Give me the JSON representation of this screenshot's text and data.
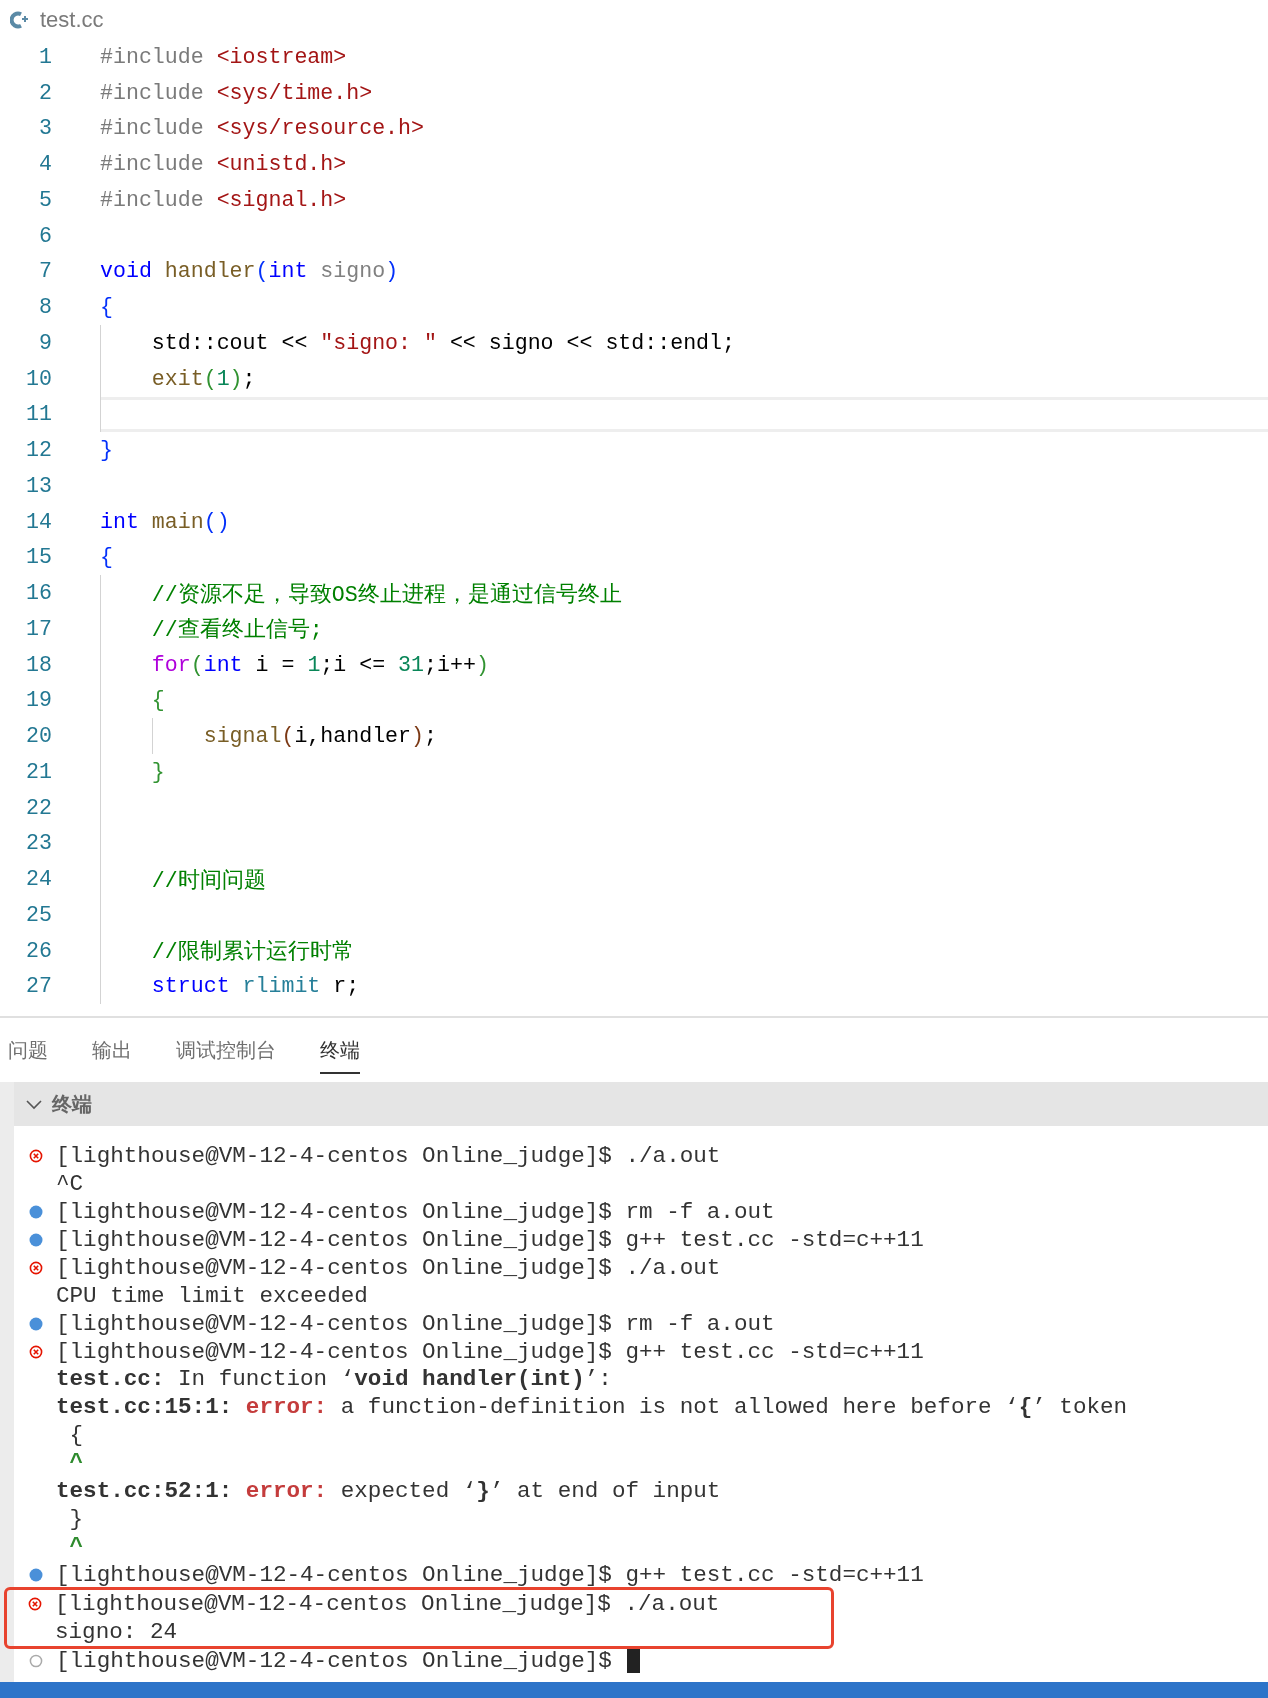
{
  "editor": {
    "file_name": "test.cc",
    "lines": [
      {
        "number": "1",
        "current": false,
        "tokens": [
          {
            "text": "#include ",
            "kind": "directive"
          },
          {
            "text": "<iostream>",
            "kind": "string"
          }
        ]
      },
      {
        "number": "2",
        "current": false,
        "tokens": [
          {
            "text": "#include ",
            "kind": "directive"
          },
          {
            "text": "<sys/time.h>",
            "kind": "string"
          }
        ]
      },
      {
        "number": "3",
        "current": false,
        "tokens": [
          {
            "text": "#include ",
            "kind": "directive"
          },
          {
            "text": "<sys/resource.h>",
            "kind": "string"
          }
        ]
      },
      {
        "number": "4",
        "current": false,
        "tokens": [
          {
            "text": "#include ",
            "kind": "directive"
          },
          {
            "text": "<unistd.h>",
            "kind": "string"
          }
        ]
      },
      {
        "number": "5",
        "current": false,
        "tokens": [
          {
            "text": "#include ",
            "kind": "directive"
          },
          {
            "text": "<signal.h>",
            "kind": "string"
          }
        ]
      },
      {
        "number": "6",
        "current": false
      },
      {
        "number": "7",
        "current": false,
        "tokens": [
          {
            "text": "void ",
            "kind": "keyword"
          },
          {
            "text": "handler",
            "kind": "function"
          },
          {
            "text": "(",
            "kind": "bracket1"
          },
          {
            "text": "int ",
            "kind": "keyword"
          },
          {
            "text": "signo",
            "kind": "param"
          },
          {
            "text": ")",
            "kind": "bracket1"
          }
        ]
      },
      {
        "number": "8",
        "current": false,
        "tokens": [
          {
            "text": "{",
            "kind": "bracket1"
          }
        ]
      },
      {
        "number": "9",
        "current": false,
        "tokens": [
          {
            "text": "    std::cout << ",
            "kind": "plain"
          },
          {
            "text": "\"signo: \"",
            "kind": "string"
          },
          {
            "text": " << signo << std::endl;",
            "kind": "plain"
          }
        ]
      },
      {
        "number": "10",
        "current": false,
        "tokens": [
          {
            "text": "    exit",
            "kind": "function"
          },
          {
            "text": "(",
            "kind": "bracket2"
          },
          {
            "text": "1",
            "kind": "number"
          },
          {
            "text": ")",
            "kind": "bracket2"
          },
          {
            "text": ";",
            "kind": "plain"
          }
        ]
      },
      {
        "number": "11",
        "current": true
      },
      {
        "number": "12",
        "current": false,
        "tokens": [
          {
            "text": "}",
            "kind": "bracket1"
          }
        ]
      },
      {
        "number": "13",
        "current": false
      },
      {
        "number": "14",
        "current": false,
        "tokens": [
          {
            "text": "int ",
            "kind": "keyword"
          },
          {
            "text": "main",
            "kind": "function"
          },
          {
            "text": "()",
            "kind": "bracket1"
          }
        ]
      },
      {
        "number": "15",
        "current": false,
        "tokens": [
          {
            "text": "{",
            "kind": "bracket1"
          }
        ]
      },
      {
        "number": "16",
        "current": false,
        "tokens": [
          {
            "text": "    //资源不足，导致OS终止进程，是通过信号终止",
            "kind": "comment"
          }
        ]
      },
      {
        "number": "17",
        "current": false,
        "tokens": [
          {
            "text": "    //查看终止信号;",
            "kind": "comment"
          }
        ]
      },
      {
        "number": "18",
        "current": false,
        "tokens": [
          {
            "text": "    for",
            "kind": "control"
          },
          {
            "text": "(",
            "kind": "bracket2"
          },
          {
            "text": "int",
            "kind": "keyword"
          },
          {
            "text": " i = ",
            "kind": "plain"
          },
          {
            "text": "1",
            "kind": "number"
          },
          {
            "text": ";i <= ",
            "kind": "plain"
          },
          {
            "text": "31",
            "kind": "number"
          },
          {
            "text": ";i++",
            "kind": "plain"
          },
          {
            "text": ")",
            "kind": "bracket2"
          }
        ]
      },
      {
        "number": "19",
        "current": false,
        "tokens": [
          {
            "text": "    {",
            "kind": "bracket2"
          }
        ]
      },
      {
        "number": "20",
        "current": false,
        "tokens": [
          {
            "text": "        signal",
            "kind": "function"
          },
          {
            "text": "(",
            "kind": "bracket3"
          },
          {
            "text": "i,handler",
            "kind": "plain"
          },
          {
            "text": ")",
            "kind": "bracket3"
          },
          {
            "text": ";",
            "kind": "plain"
          }
        ]
      },
      {
        "number": "21",
        "current": false,
        "tokens": [
          {
            "text": "    }",
            "kind": "bracket2"
          }
        ]
      },
      {
        "number": "22",
        "current": false
      },
      {
        "number": "23",
        "current": false
      },
      {
        "number": "24",
        "current": false,
        "tokens": [
          {
            "text": "    //时间问题",
            "kind": "comment"
          }
        ]
      },
      {
        "number": "25",
        "current": false
      },
      {
        "number": "26",
        "current": false,
        "tokens": [
          {
            "text": "    //限制累计运行时常",
            "kind": "comment"
          }
        ]
      },
      {
        "number": "27",
        "current": false,
        "tokens": [
          {
            "text": "    struct ",
            "kind": "keyword"
          },
          {
            "text": "rlimit",
            "kind": "type"
          },
          {
            "text": " r;",
            "kind": "plain"
          }
        ]
      }
    ]
  },
  "panel": {
    "tabs": [
      {
        "label": "问题",
        "selected": false
      },
      {
        "label": "输出",
        "selected": false
      },
      {
        "label": "调试控制台",
        "selected": false
      },
      {
        "label": "终端",
        "selected": true
      }
    ]
  },
  "terminal": {
    "title": "终端",
    "expanded": true,
    "lines": [
      {
        "kind": "error",
        "highlighted": false,
        "cursor": false,
        "parts": [
          {
            "text": "[lighthouse@VM-12-4-centos Online_judge]$ ./a.out",
            "kind": "plain"
          }
        ]
      },
      {
        "highlighted": false,
        "cursor": false,
        "parts": [
          {
            "text": "^C",
            "kind": "plain"
          }
        ]
      },
      {
        "kind": "success",
        "highlighted": false,
        "cursor": false,
        "parts": [
          {
            "text": "[lighthouse@VM-12-4-centos Online_judge]$ rm -f a.out",
            "kind": "plain"
          }
        ]
      },
      {
        "kind": "success",
        "highlighted": false,
        "cursor": false,
        "parts": [
          {
            "text": "[lighthouse@VM-12-4-centos Online_judge]$ g++ test.cc -std=c++11",
            "kind": "plain"
          }
        ]
      },
      {
        "kind": "error",
        "highlighted": false,
        "cursor": false,
        "parts": [
          {
            "text": "[lighthouse@VM-12-4-centos Online_judge]$ ./a.out",
            "kind": "plain"
          }
        ]
      },
      {
        "highlighted": false,
        "cursor": false,
        "parts": [
          {
            "text": "CPU time limit exceeded",
            "kind": "plain"
          }
        ]
      },
      {
        "kind": "success",
        "highlighted": false,
        "cursor": false,
        "parts": [
          {
            "text": "[lighthouse@VM-12-4-centos Online_judge]$ rm -f a.out",
            "kind": "plain"
          }
        ]
      },
      {
        "kind": "error",
        "highlighted": false,
        "cursor": false,
        "parts": [
          {
            "text": "[lighthouse@VM-12-4-centos Online_judge]$ g++ test.cc -std=c++11",
            "kind": "plain"
          }
        ]
      },
      {
        "highlighted": false,
        "cursor": false,
        "parts": [
          {
            "text": "test.cc:",
            "kind": "bold"
          },
          {
            "text": " In function ‘",
            "kind": "plain"
          },
          {
            "text": "void handler(int)",
            "kind": "bold"
          },
          {
            "text": "’:",
            "kind": "plain"
          }
        ]
      },
      {
        "highlighted": false,
        "cursor": false,
        "parts": [
          {
            "text": "test.cc:15:1: ",
            "kind": "bold"
          },
          {
            "text": "error:",
            "kind": "error"
          },
          {
            "text": " a function-definition is not allowed here before ‘",
            "kind": "plain"
          },
          {
            "text": "{",
            "kind": "bold"
          },
          {
            "text": "’ token",
            "kind": "plain"
          }
        ]
      },
      {
        "highlighted": false,
        "cursor": false,
        "parts": [
          {
            "text": " {",
            "kind": "plain"
          }
        ]
      },
      {
        "highlighted": false,
        "cursor": false,
        "parts": [
          {
            "text": " ^",
            "kind": "caret"
          }
        ]
      },
      {
        "highlighted": false,
        "cursor": false,
        "parts": [
          {
            "text": "test.cc:52:1: ",
            "kind": "bold"
          },
          {
            "text": "error:",
            "kind": "error"
          },
          {
            "text": " expected ‘",
            "kind": "plain"
          },
          {
            "text": "}",
            "kind": "bold"
          },
          {
            "text": "’ at end of input",
            "kind": "plain"
          }
        ]
      },
      {
        "highlighted": false,
        "cursor": false,
        "parts": [
          {
            "text": " }",
            "kind": "plain"
          }
        ]
      },
      {
        "highlighted": false,
        "cursor": false,
        "parts": [
          {
            "text": " ^",
            "kind": "caret"
          }
        ]
      },
      {
        "kind": "success",
        "highlighted": false,
        "cursor": false,
        "parts": [
          {
            "text": "[lighthouse@VM-12-4-centos Online_judge]$ g++ test.cc -std=c++11",
            "kind": "plain"
          }
        ]
      },
      {
        "kind": "error",
        "highlighted": true,
        "cursor": false,
        "parts": [
          {
            "text": "[lighthouse@VM-12-4-centos Online_judge]$ ./a.out",
            "kind": "plain"
          }
        ]
      },
      {
        "highlighted": true,
        "cursor": false,
        "parts": [
          {
            "text": "signo: 24",
            "kind": "plain"
          }
        ]
      },
      {
        "kind": "idle",
        "highlighted": false,
        "cursor": true,
        "parts": [
          {
            "text": "[lighthouse@VM-12-4-centos Online_judge]$ ",
            "kind": "plain"
          }
        ]
      }
    ]
  }
}
